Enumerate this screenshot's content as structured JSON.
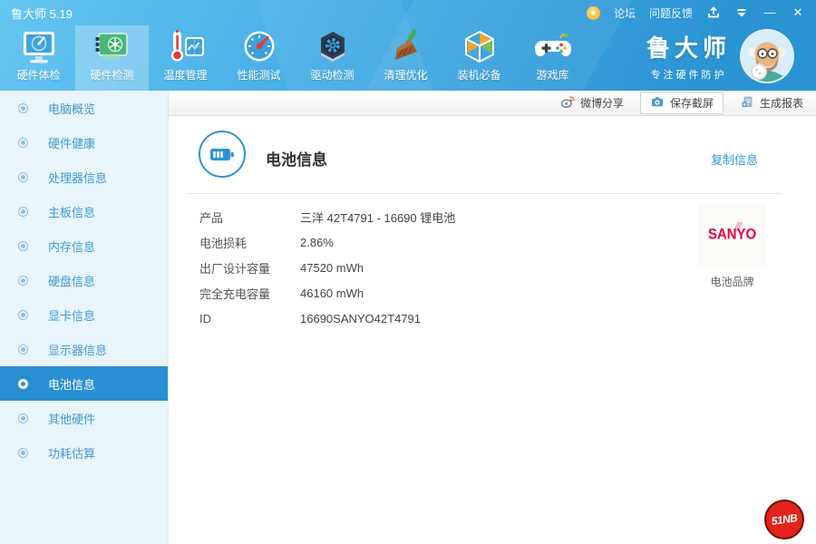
{
  "window": {
    "title": "鲁大师 5.19"
  },
  "titlebar": {
    "links": [
      {
        "label": "论坛"
      },
      {
        "label": "问题反馈"
      }
    ],
    "icons": [
      "medal-icon",
      "share-icon",
      "menu-arrow-icon",
      "minimize-icon",
      "close-icon"
    ],
    "minimize_glyph": "—",
    "close_glyph": "✕"
  },
  "toolbar": {
    "items": [
      {
        "label": "硬件体检",
        "icon": "monitor-scan-icon",
        "active": false
      },
      {
        "label": "硬件检测",
        "icon": "gpu-card-icon",
        "active": true
      },
      {
        "label": "温度管理",
        "icon": "thermometer-chart-icon",
        "active": false
      },
      {
        "label": "性能测试",
        "icon": "gauge-icon",
        "active": false
      },
      {
        "label": "驱动检测",
        "icon": "gear-hexagon-icon",
        "active": false
      },
      {
        "label": "清理优化",
        "icon": "broom-icon",
        "active": false
      },
      {
        "label": "装机必备",
        "icon": "cube-icon",
        "active": false
      },
      {
        "label": "游戏库",
        "icon": "gamepad-icon",
        "active": false
      }
    ]
  },
  "brand": {
    "name": "鲁大师",
    "slogan": "专注硬件防护",
    "avatar": "mascot-avatar"
  },
  "actionbar": {
    "buttons": [
      {
        "label": "微博分享",
        "icon": "weibo-icon",
        "highlighted": false
      },
      {
        "label": "保存截屏",
        "icon": "camera-icon",
        "highlighted": true
      },
      {
        "label": "生成报表",
        "icon": "report-icon",
        "highlighted": false
      }
    ]
  },
  "sidebar": {
    "items": [
      {
        "label": "电脑概览",
        "active": false
      },
      {
        "label": "硬件健康",
        "active": false
      },
      {
        "label": "处理器信息",
        "active": false
      },
      {
        "label": "主板信息",
        "active": false
      },
      {
        "label": "内存信息",
        "active": false
      },
      {
        "label": "硬盘信息",
        "active": false
      },
      {
        "label": "显卡信息",
        "active": false
      },
      {
        "label": "显示器信息",
        "active": false
      },
      {
        "label": "电池信息",
        "active": true
      },
      {
        "label": "其他硬件",
        "active": false
      },
      {
        "label": "功耗估算",
        "active": false
      }
    ]
  },
  "main": {
    "title": "电池信息",
    "title_icon": "battery-icon",
    "copy_link": "复制信息",
    "rows": [
      {
        "label": "产品",
        "value": "三洋 42T4791 - 16690 锂电池"
      },
      {
        "label": "电池损耗",
        "value": "2.86%"
      },
      {
        "label": "出厂设计容量",
        "value": "47520 mWh"
      },
      {
        "label": "完全充电容量",
        "value": "46160 mWh"
      },
      {
        "label": "ID",
        "value": "16690SANYO42T4791"
      }
    ],
    "brand_panel": {
      "logo_text": "SANYO",
      "caption": "电池品牌"
    },
    "watermark": "51NB"
  },
  "colors": {
    "accent": "#2d9ad3",
    "header_gradient_start": "#66c6f2",
    "header_gradient_end": "#2a93d2",
    "sidebar_bg": "#e9f4fb",
    "sidebar_active": "#2a90d4",
    "sanyo_red": "#e50040",
    "watermark_red": "#e32219",
    "medal_gold": "#f0a90f"
  }
}
